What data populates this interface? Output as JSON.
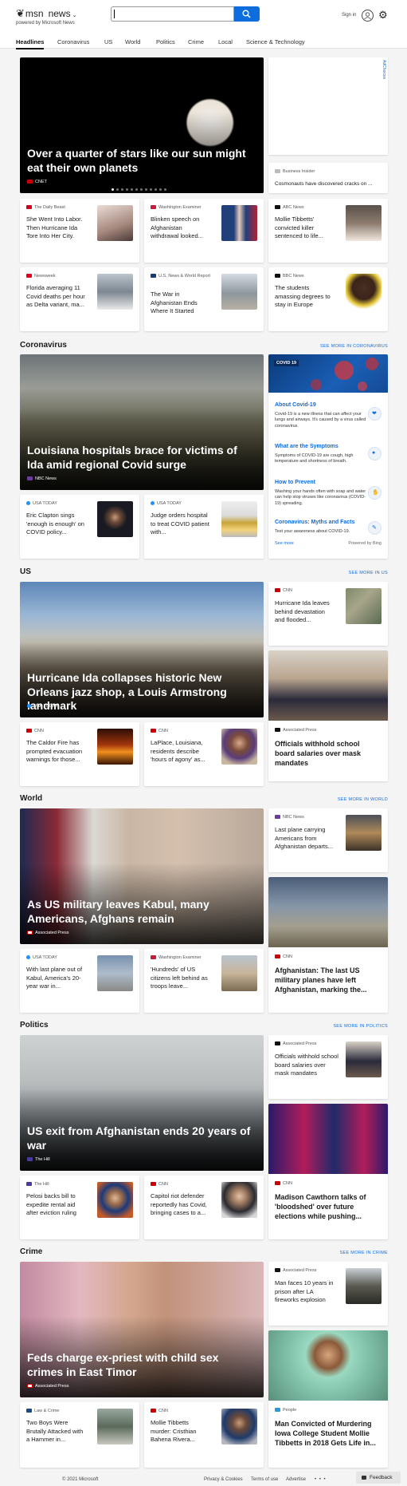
{
  "header": {
    "logo_msn": "msn",
    "logo_news": "news",
    "tagline": "powered by Microsoft News",
    "search_value": "",
    "signin": "Sign in"
  },
  "nav": [
    "Headlines",
    "Coronavirus",
    "US",
    "World",
    "Politics",
    "Crime",
    "Local",
    "Science & Technology"
  ],
  "headlines": {
    "hero": {
      "title": "Over a quarter of stars like our sun might eat their own planets",
      "source": "CNET"
    },
    "ad_label": "AdChoices",
    "side": {
      "source": "Business Insider",
      "title": "Cosmonauts have discovered cracks on ..."
    },
    "cards": [
      {
        "source": "The Daily Beast",
        "title": "She Went Into Labor. Then Hurricane Ida Tore Into Her City."
      },
      {
        "source": "Washington Examiner",
        "title": "Blinken speech on Afghanistan withdrawal looked..."
      },
      {
        "source": "ABC News",
        "title": "Mollie Tibbetts' convicted killer sentenced to life..."
      },
      {
        "source": "Newsweek",
        "title": "Florida averaging 11 Covid deaths per hour as Delta variant, ma..."
      },
      {
        "source": "U.S. News & World Report",
        "title": "The War in Afghanistan Ends Where It Started"
      },
      {
        "source": "BBC News",
        "title": "The students amassing degrees to stay in Europe"
      }
    ]
  },
  "coronavirus": {
    "heading": "Coronavirus",
    "see_more": "SEE MORE IN CORONAVIRUS",
    "hero": {
      "title": "Louisiana hospitals brace for victims of Ida amid regional Covid surge",
      "source": "NBC News"
    },
    "cards": [
      {
        "source": "USA TODAY",
        "title": "Eric Clapton sings 'enough is enough' on COVID policy..."
      },
      {
        "source": "USA TODAY",
        "title": "Judge orders hospital to treat COVID patient with..."
      }
    ],
    "panel": {
      "tag": "COVID 19",
      "items": [
        {
          "title": "About Covid-19",
          "desc": "Covid-19 is a new illness that can affect your lungs and airways. It's caused by a virus called coronavirus."
        },
        {
          "title": "What are the Symptoms",
          "desc": "Symptoms of COVID-19 are cough, high temperature and shortness of breath."
        },
        {
          "title": "How to Prevent",
          "desc": "Washing your hands often with soap and water can help stop viruses like coronavirus (COVID-19) spreading."
        },
        {
          "title": "Coronavirus: Myths and Facts",
          "desc": "Test your awareness about COVID-19."
        }
      ],
      "see_more": "See more",
      "powered": "Powered by Bing"
    }
  },
  "us": {
    "heading": "US",
    "see_more": "SEE MORE IN US",
    "hero": {
      "title": "Hurricane Ida collapses historic New Orleans jazz shop, a Louis Armstrong landmark",
      "source": "USA TODAY"
    },
    "side": {
      "source": "CNN",
      "title": "Hurricane Ida leaves behind devastation and flooded..."
    },
    "tall": {
      "source": "Associated Press",
      "title": "Officials withhold school board salaries over mask mandates"
    },
    "cards": [
      {
        "source": "CNN",
        "title": "The Caldor Fire has prompted evacuation warnings for those..."
      },
      {
        "source": "CNN",
        "title": "LaPlace, Louisiana, residents describe 'hours of agony' as..."
      }
    ]
  },
  "world": {
    "heading": "World",
    "see_more": "SEE MORE IN WORLD",
    "hero": {
      "title": "As US military leaves Kabul, many Americans, Afghans remain",
      "source": "Associated Press"
    },
    "side": {
      "source": "NBC News",
      "title": "Last plane carrying Americans from Afghanistan departs..."
    },
    "tall": {
      "source": "CNN",
      "title": "Afghanistan: The last US military planes have left Afghanistan, marking the..."
    },
    "cards": [
      {
        "source": "USA TODAY",
        "title": "With last plane out of Kabul, America's 20-year war in..."
      },
      {
        "source": "Washington Examiner",
        "title": "'Hundreds' of US citizens left behind as troops leave..."
      }
    ]
  },
  "politics": {
    "heading": "Politics",
    "see_more": "SEE MORE IN POLITICS",
    "hero": {
      "title": "US exit from Afghanistan ends 20 years of war",
      "source": "The Hill"
    },
    "side": {
      "source": "Associated Press",
      "title": "Officials withhold school board salaries over mask mandates"
    },
    "tall": {
      "source": "CNN",
      "title": "Madison Cawthorn talks of 'bloodshed' over future elections while pushing..."
    },
    "cards": [
      {
        "source": "The Hill",
        "title": "Pelosi backs bill to expedite rental aid after eviction ruling"
      },
      {
        "source": "CNN",
        "title": "Capitol riot defender reportedly has Covid, bringing cases to a..."
      }
    ]
  },
  "crime": {
    "heading": "Crime",
    "see_more": "SEE MORE IN CRIME",
    "hero": {
      "title": "Feds charge ex-priest with child sex crimes in East Timor",
      "source": "Associated Press"
    },
    "side": {
      "source": "Associated Press",
      "title": "Man faces 10 years in prison after LA fireworks explosion"
    },
    "tall": {
      "source": "People",
      "title": "Man Convicted of Murdering Iowa College Student Mollie Tibbetts in 2018 Gets Life in..."
    },
    "cards": [
      {
        "source": "Law & Crime",
        "title": "Two Boys Were Brutally Attacked with a Hammer in..."
      },
      {
        "source": "CNN",
        "title": "Mollie Tibbetts murder: Cristhian Bahena Rivera..."
      }
    ]
  },
  "footer": {
    "copyright": "© 2021 Microsoft",
    "privacy": "Privacy & Cookies",
    "terms": "Terms of use",
    "advertise": "Advertise",
    "more": "• • •",
    "feedback": "Feedback"
  }
}
